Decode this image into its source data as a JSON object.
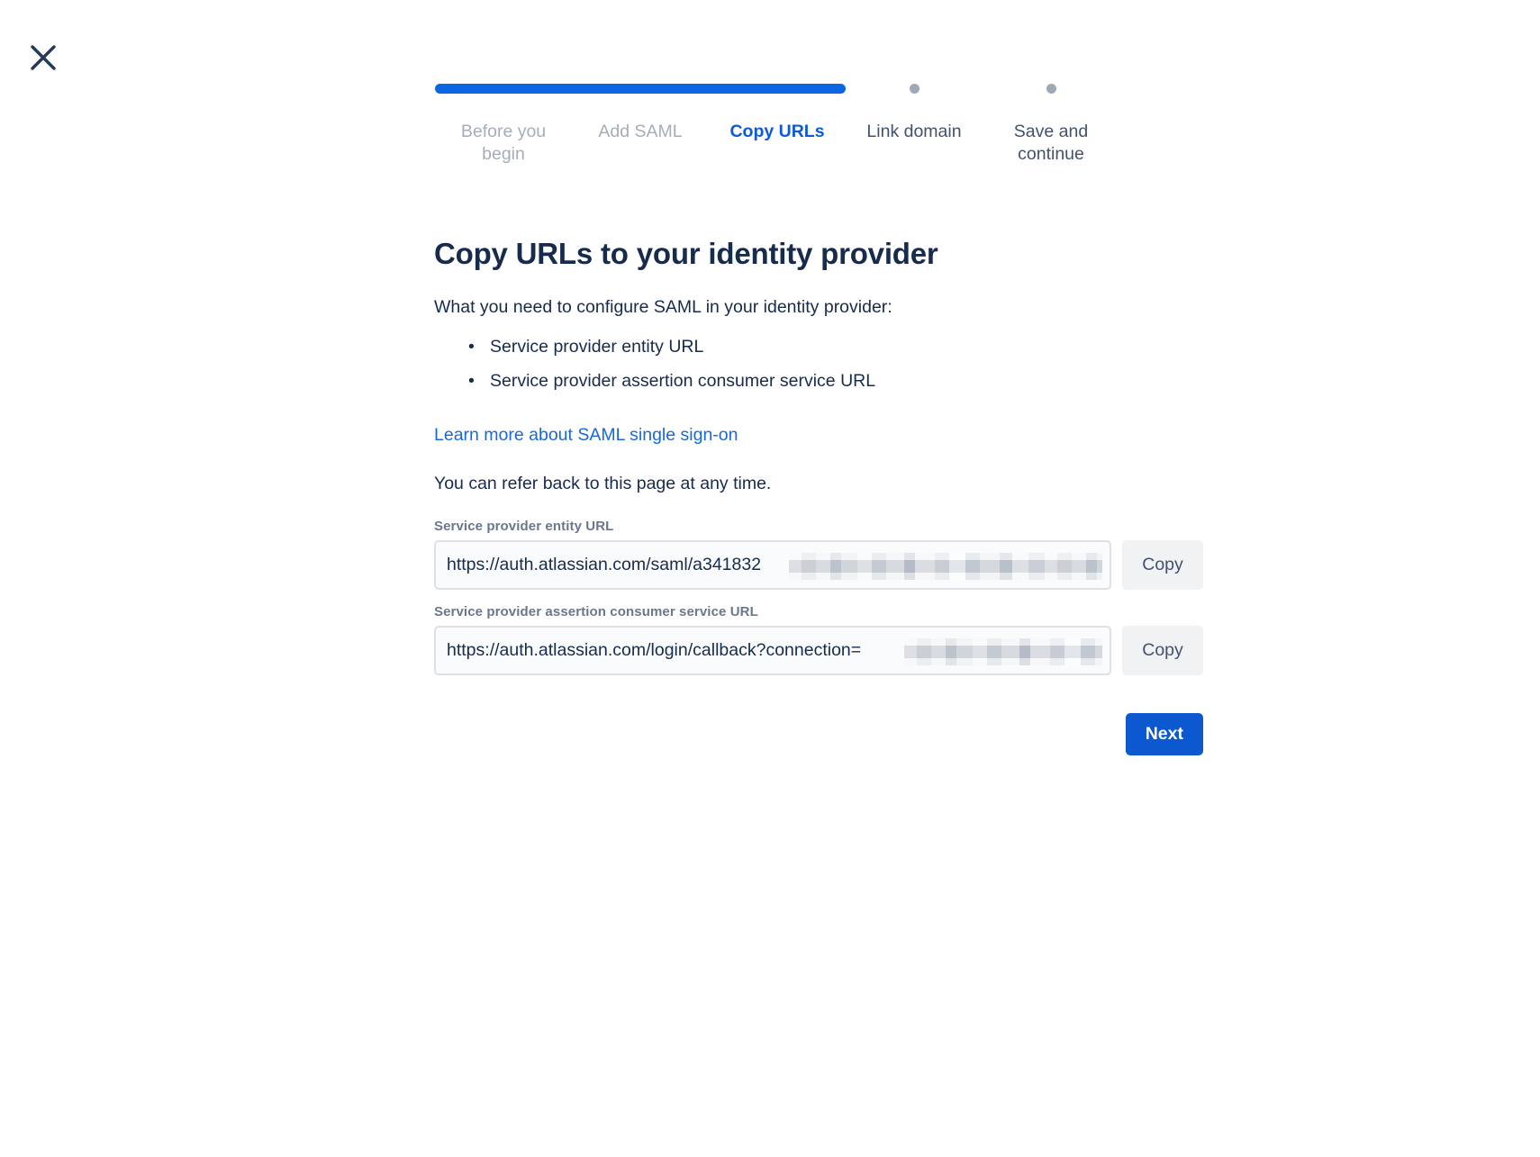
{
  "window": {
    "close_icon": "close-icon"
  },
  "stepper": {
    "steps": [
      {
        "label": "Before you\nbegin",
        "state": "done",
        "marker": "bar"
      },
      {
        "label": "Add SAML",
        "state": "done",
        "marker": "bar"
      },
      {
        "label": "Copy URLs",
        "state": "current",
        "marker": "bar"
      },
      {
        "label": "Link domain",
        "state": "todo",
        "marker": "dot"
      },
      {
        "label": "Save and\ncontinue",
        "state": "todo",
        "marker": "dot"
      }
    ],
    "accent_color": "#0c66e4",
    "inactive_dot_color": "#9fa8b8",
    "current_label_color": "#0c5bd6",
    "done_label_color": "#a5adba"
  },
  "main": {
    "title": "Copy URLs to your identity provider",
    "lede": "What you need to configure SAML in your identity provider:",
    "requirements": [
      "Service provider entity URL",
      "Service provider assertion consumer service URL"
    ],
    "learn_more_link": "Learn more about SAML single sign-on",
    "refer_note": "You can refer back to this page at any time.",
    "fields": [
      {
        "label": "Service provider entity URL",
        "value": "https://auth.atlassian.com/saml/a341832",
        "redacted": true,
        "copy_label": "Copy"
      },
      {
        "label": "Service provider assertion consumer service URL",
        "value": "https://auth.atlassian.com/login/callback?connection=",
        "redacted": true,
        "copy_label": "Copy"
      }
    ],
    "next_label": "Next"
  }
}
